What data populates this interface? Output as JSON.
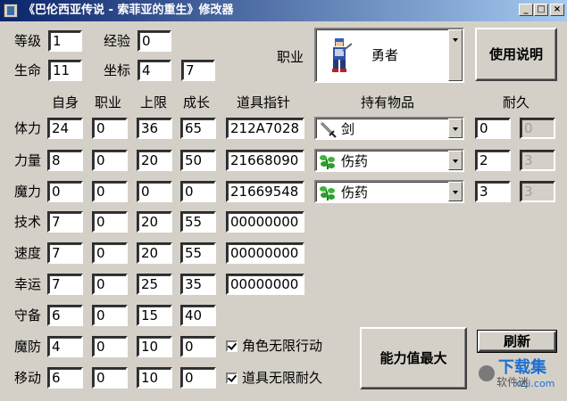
{
  "window": {
    "title": "《巴伦西亚传说 - 索菲亚的重生》修改器",
    "controls": {
      "minimize": "_",
      "maximize": "□",
      "close": "×"
    }
  },
  "top": {
    "level_label": "等级",
    "level_value": "1",
    "exp_label": "经验",
    "exp_value": "0",
    "hp_label": "生命",
    "hp_value": "11",
    "coord_label": "坐标",
    "coord_x": "4",
    "coord_y": "7",
    "job_label": "职业",
    "job_value": "勇者",
    "help_button": "使用说明"
  },
  "headers": {
    "self": "自身",
    "job": "职业",
    "limit": "上限",
    "growth": "成长",
    "pointer": "道具指针",
    "items": "持有物品",
    "durability": "耐久"
  },
  "stats": [
    {
      "label": "体力",
      "self": "24",
      "job": "0",
      "limit": "36",
      "growth": "65",
      "pointer": "212A7028"
    },
    {
      "label": "力量",
      "self": "8",
      "job": "0",
      "limit": "20",
      "growth": "50",
      "pointer": "21668090"
    },
    {
      "label": "魔力",
      "self": "0",
      "job": "0",
      "limit": "0",
      "growth": "0",
      "pointer": "21669548"
    },
    {
      "label": "技术",
      "self": "7",
      "job": "0",
      "limit": "20",
      "growth": "55",
      "pointer": "00000000"
    },
    {
      "label": "速度",
      "self": "7",
      "job": "0",
      "limit": "20",
      "growth": "55",
      "pointer": "00000000"
    },
    {
      "label": "幸运",
      "self": "7",
      "job": "0",
      "limit": "25",
      "growth": "35",
      "pointer": "00000000"
    },
    {
      "label": "守备",
      "self": "6",
      "job": "0",
      "limit": "15",
      "growth": "40"
    },
    {
      "label": "魔防",
      "self": "4",
      "job": "0",
      "limit": "10",
      "growth": "0"
    },
    {
      "label": "移动",
      "self": "6",
      "job": "0",
      "limit": "10",
      "growth": "0"
    }
  ],
  "items": [
    {
      "name": "剑",
      "icon": "sword-icon",
      "durability": "0",
      "max": "0"
    },
    {
      "name": "伤药",
      "icon": "herb-icon",
      "durability": "2",
      "max": "3"
    },
    {
      "name": "伤药",
      "icon": "herb-icon",
      "durability": "3",
      "max": "3"
    }
  ],
  "checkboxes": {
    "unlimited_action": "角色无限行动",
    "unlimited_durability": "道具无限耐久"
  },
  "buttons": {
    "refresh": "刷新",
    "max_stats": "能力值最大"
  },
  "watermark": {
    "brand": "下载集",
    "sub": "xzji.com",
    "account": "软件迷"
  }
}
